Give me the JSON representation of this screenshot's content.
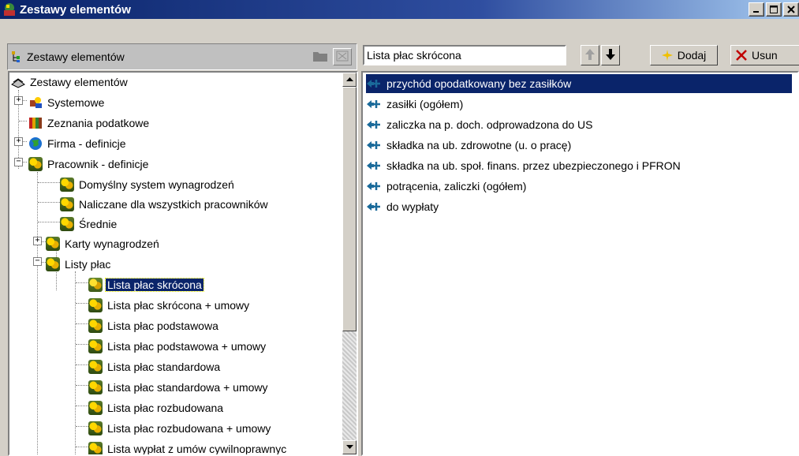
{
  "window": {
    "title": "Zestawy elementów",
    "controls": [
      "_",
      "□",
      "×"
    ]
  },
  "left_header": {
    "title": "Zestawy elementów"
  },
  "tree": {
    "items": [
      {
        "label": "Zestawy elementów",
        "icon": "stack-icon"
      },
      {
        "label": "Systemowe",
        "icon": "system-icon"
      },
      {
        "label": "Zeznania podatkowe",
        "icon": "books-icon"
      },
      {
        "label": "Firma - definicje",
        "icon": "globe-icon"
      },
      {
        "label": "Pracownik - definicje",
        "icon": "people-icon"
      },
      {
        "label": "Domyślny system wynagrodzeń",
        "icon": "people-icon"
      },
      {
        "label": "Naliczane dla wszystkich pracowników",
        "icon": "people-icon"
      },
      {
        "label": "Średnie",
        "icon": "people-icon"
      },
      {
        "label": "Karty wynagrodzeń",
        "icon": "people-icon"
      },
      {
        "label": "Listy płac",
        "icon": "people-icon"
      },
      {
        "label": "Lista płac skrócona",
        "icon": "people-icon",
        "selected": true
      },
      {
        "label": "Lista płac skrócona + umowy",
        "icon": "people-icon"
      },
      {
        "label": "Lista płac podstawowa",
        "icon": "people-icon"
      },
      {
        "label": "Lista płac podstawowa + umowy",
        "icon": "people-icon"
      },
      {
        "label": "Lista płac standardowa",
        "icon": "people-icon"
      },
      {
        "label": "Lista płac standardowa + umowy",
        "icon": "people-icon"
      },
      {
        "label": "Lista płac rozbudowana",
        "icon": "people-icon"
      },
      {
        "label": "Lista płac rozbudowana + umowy",
        "icon": "people-icon"
      },
      {
        "label": "Lista wypłat z umów cywilnoprawnyc",
        "icon": "people-icon"
      }
    ]
  },
  "toolbar": {
    "list_name": "Lista płac skrócona",
    "add_label": "Dodaj",
    "remove_label": "Usun"
  },
  "elements": {
    "items": [
      {
        "label": "przychód opodatkowany bez zasiłków",
        "selected": true
      },
      {
        "label": "zasiłki (ogółem)"
      },
      {
        "label": "zaliczka na p. doch. odprowadzona do US"
      },
      {
        "label": "składka na ub. zdrowotne (u. o pracę)"
      },
      {
        "label": "składka na ub. społ. finans. przez ubezpieczonego i PFRON"
      },
      {
        "label": "potrącenia, zaliczki (ogółem)"
      },
      {
        "label": "do wypłaty"
      }
    ]
  },
  "colors": {
    "selection": "#0a246a",
    "titlebar_start": "#0a246a",
    "titlebar_end": "#a6caf0"
  }
}
